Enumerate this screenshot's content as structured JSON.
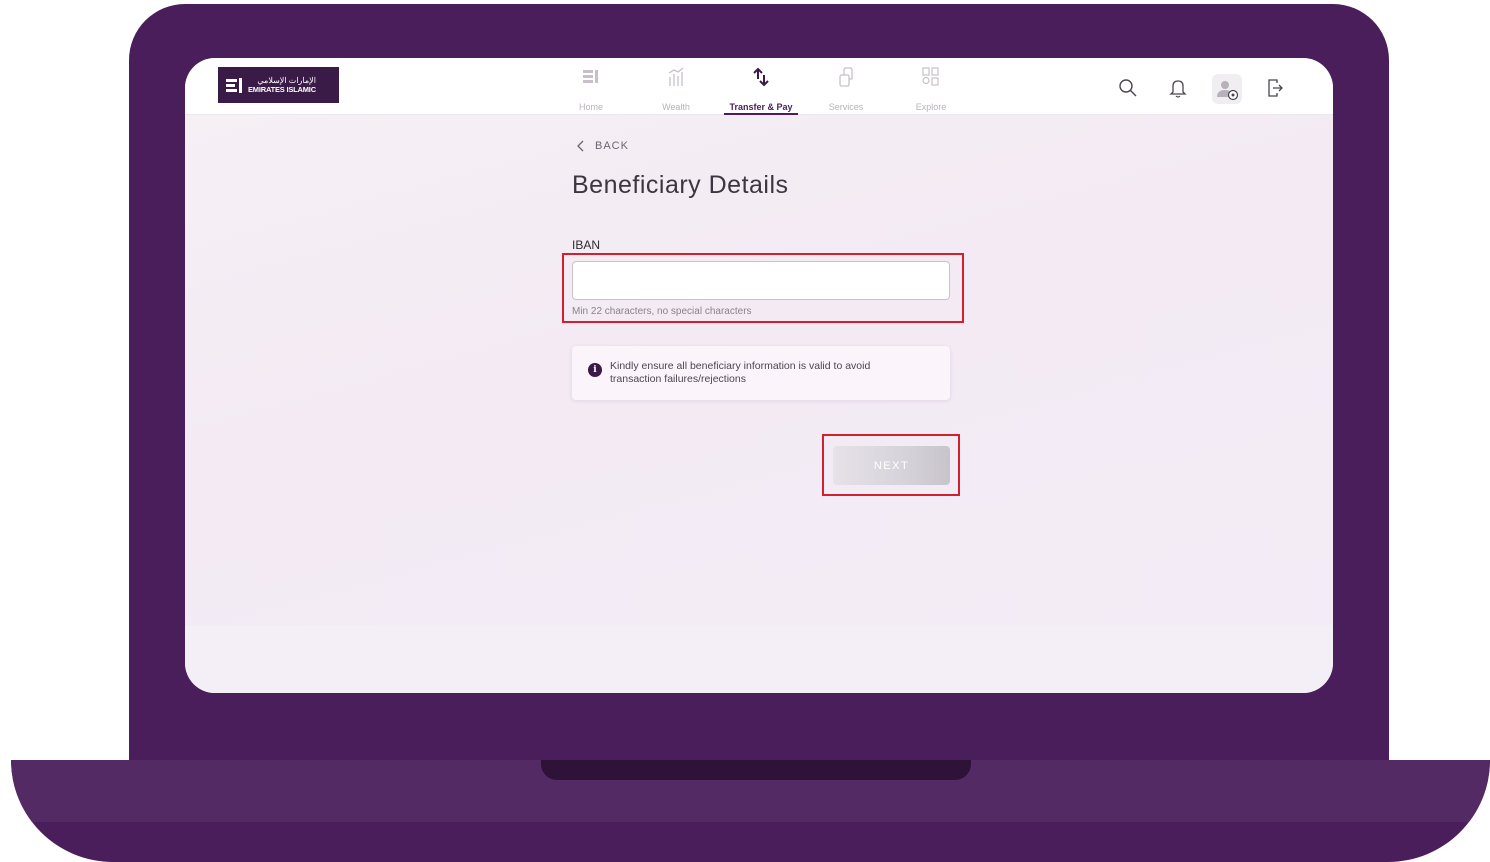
{
  "brand": {
    "logo_ar": "الإمارات الإسلامي",
    "logo_en": "EMIRATES ISLAMIC",
    "accent": "#4a1e5a",
    "highlight": "#d3202e"
  },
  "nav": {
    "items": [
      {
        "label": "Home",
        "icon": "home-icon",
        "active": false
      },
      {
        "label": "Wealth",
        "icon": "wealth-chart-icon",
        "active": false
      },
      {
        "label": "Transfer & Pay",
        "icon": "transfer-arrows-icon",
        "active": true
      },
      {
        "label": "Services",
        "icon": "services-icon",
        "active": false
      },
      {
        "label": "Explore",
        "icon": "explore-grid-icon",
        "active": false
      }
    ],
    "actions": [
      "search-icon",
      "bell-icon",
      "profile-settings-icon",
      "logout-icon"
    ]
  },
  "page": {
    "back_label": "BACK",
    "title": "Beneficiary Details"
  },
  "form": {
    "iban_label": "IBAN",
    "iban_value": "",
    "iban_hint": "Min 22 characters, no special characters"
  },
  "notice": {
    "text": "Kindly ensure all beneficiary information is valid to avoid transaction failures/rejections"
  },
  "actions": {
    "next_label": "NEXT",
    "next_enabled": false
  }
}
